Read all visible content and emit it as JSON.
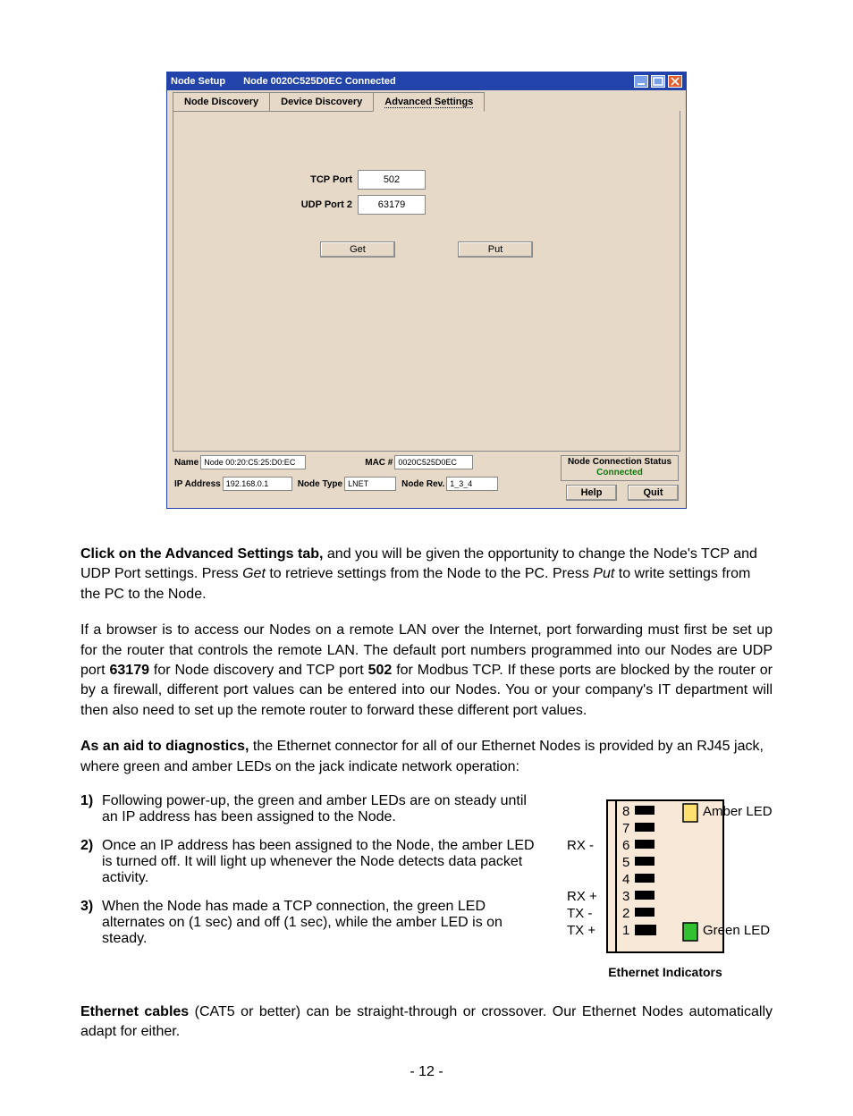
{
  "window": {
    "title_left": "Node Setup",
    "title_mid": "Node 0020C525D0EC Connected",
    "tabs": [
      "Node Discovery",
      "Device Discovery",
      "Advanced Settings"
    ],
    "tcp_label": "TCP Port",
    "udp_label": "UDP Port 2",
    "tcp_value": "502",
    "udp_value": "63179",
    "get_label": "Get",
    "put_label": "Put",
    "name_label": "Name",
    "name_value": "Node 00:20:C5:25:D0:EC",
    "mac_label": "MAC #",
    "mac_value": "0020C525D0EC",
    "ip_label": "IP Address",
    "ip_value": "192.168.0.1",
    "type_label": "Node Type",
    "type_value": "LNET",
    "rev_label": "Node Rev.",
    "rev_value": "1_3_4",
    "status_hdr": "Node Connection Status",
    "status_val": "Connected",
    "help_label": "Help",
    "quit_label": "Quit"
  },
  "text": {
    "p1a": "Click on the Advanced Settings tab,",
    "p1b": " and you will be given the opportunity to change the Node's TCP and UDP Port settings. Press ",
    "p1c": "Get",
    "p1d": " to retrieve settings from the Node to the PC. Press ",
    "p1e": "Put",
    "p1f": " to write settings from the PC to the Node.",
    "p2a": "If a browser is to access our Nodes on a remote LAN over the Internet, port forwarding must first be set up for the router that controls the remote LAN. The default port numbers programmed into our Nodes are UDP port ",
    "p2b": "63179",
    "p2c": " for Node discovery and TCP port ",
    "p2d": "502",
    "p2e": " for Modbus TCP. If these ports are blocked by the router or by a firewall, different port values can be entered into our Nodes. You or your company's IT department will then also need to set up the remote router to forward these different port values.",
    "p3a": "As an aid to diagnostics,",
    "p3b": " the Ethernet connector for all of our Ethernet Nodes is provided by an RJ45 jack, where green and amber LEDs on the jack indicate network  operation:",
    "l1n": "1)",
    "l1": "Following power-up, the green and amber LEDs are on steady until an IP address has been assigned to the Node.",
    "l2n": "2)",
    "l2": "Once an IP address has been assigned to the Node, the amber LED is turned off. It will light up whenever the Node detects data packet activity.",
    "l3n": "3)",
    "l3": "When the Node has made a TCP connection, the green LED alternates on (1 sec) and off (1 sec), while the amber LED is on steady.",
    "p4a": "Ethernet cables",
    "p4b": " (CAT5 or better) can be straight-through or crossover. Our Ethernet Nodes automatically adapt for either.",
    "page_num": "- 12 -"
  },
  "diagram": {
    "pins": [
      "8",
      "7",
      "6",
      "5",
      "4",
      "3",
      "2",
      "1"
    ],
    "rx_minus": "RX -",
    "rx_plus": "RX +",
    "tx_minus": "TX  -",
    "tx_plus": "TX +",
    "amber": "Amber LED",
    "green": "Green LED",
    "caption": "Ethernet Indicators"
  }
}
